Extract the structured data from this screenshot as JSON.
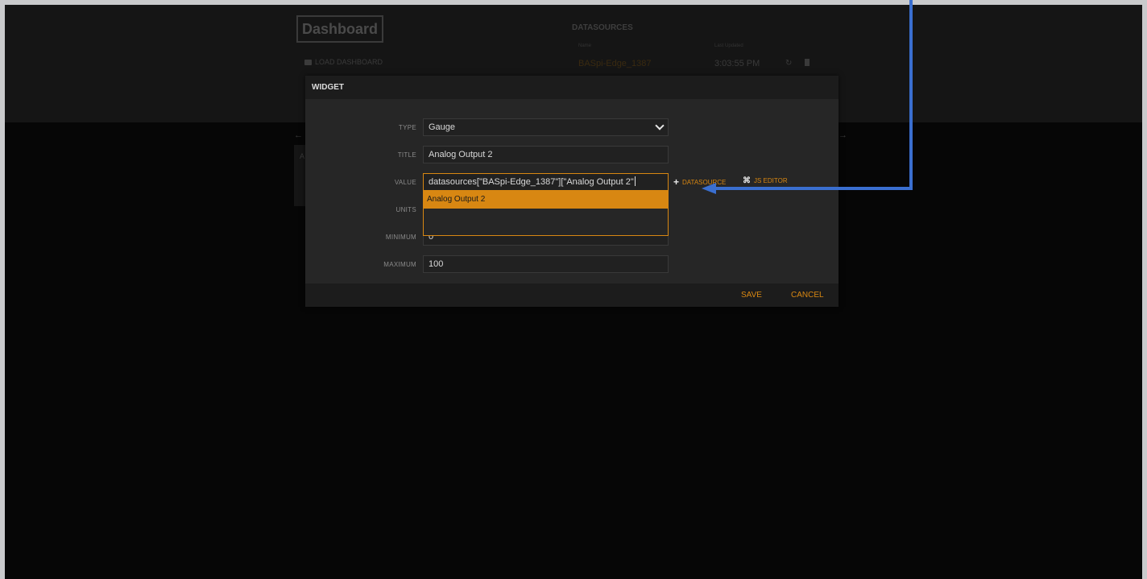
{
  "board": {
    "title": "Dashboard",
    "load_label": "LOAD DASHBOARD",
    "datasources": {
      "heading": "DATASOURCES",
      "col_name": "Name",
      "col_updated": "Last Updated",
      "rows": [
        {
          "name": "BASpi-Edge_1387",
          "updated": "3:03:55 PM"
        }
      ]
    },
    "pane_text": "A"
  },
  "modal": {
    "title": "WIDGET",
    "fields": {
      "type": {
        "label": "TYPE",
        "value": "Gauge"
      },
      "title": {
        "label": "TITLE",
        "value": "Analog Output 2"
      },
      "value": {
        "label": "VALUE",
        "value": "datasources[\"BASpi-Edge_1387\"][\"Analog Output 2\""
      },
      "units": {
        "label": "UNITS",
        "value": ""
      },
      "minimum": {
        "label": "MINIMUM",
        "value": "0"
      },
      "maximum": {
        "label": "MAXIMUM",
        "value": "100"
      }
    },
    "autocomplete": [
      "Analog Output 2"
    ],
    "actions": {
      "datasource": "DATASOURCE",
      "js_editor": "JS EDITOR"
    },
    "footer": {
      "save": "SAVE",
      "cancel": "CANCEL"
    }
  },
  "colors": {
    "accent": "#d88712",
    "annotation_arrow": "#3a6fd0"
  },
  "icons": [
    "folder-icon",
    "refresh-icon",
    "trash-icon",
    "chevron-down-icon",
    "plus-icon",
    "code-icon",
    "arrow-left-icon",
    "arrow-right-icon"
  ]
}
